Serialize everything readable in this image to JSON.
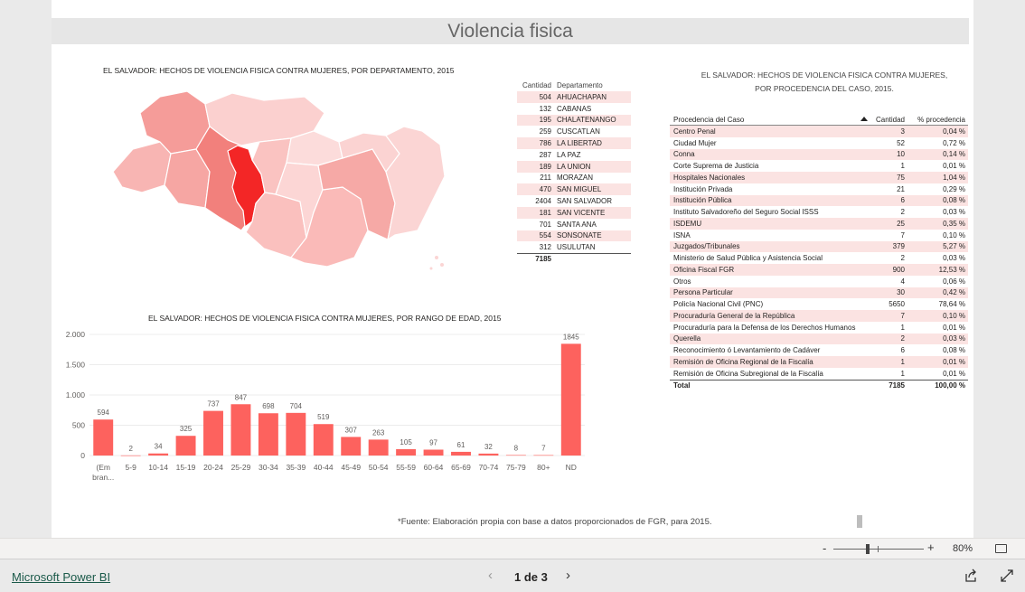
{
  "page_title": "Violencia fisica",
  "map_title": "EL SALVADOR: HECHOS DE VIOLENCIA FISICA CONTRA MUJERES, POR DEPARTAMENTO, 2015",
  "dept_table": {
    "headers": [
      "Cantidad",
      "Departamento"
    ],
    "rows": [
      {
        "qty": "504",
        "dept": "AHUACHAPAN"
      },
      {
        "qty": "132",
        "dept": "CABANAS"
      },
      {
        "qty": "195",
        "dept": "CHALATENANGO"
      },
      {
        "qty": "259",
        "dept": "CUSCATLAN"
      },
      {
        "qty": "786",
        "dept": "LA LIBERTAD"
      },
      {
        "qty": "287",
        "dept": "LA PAZ"
      },
      {
        "qty": "189",
        "dept": "LA UNION"
      },
      {
        "qty": "211",
        "dept": "MORAZAN"
      },
      {
        "qty": "470",
        "dept": "SAN MIGUEL"
      },
      {
        "qty": "2404",
        "dept": "SAN SALVADOR"
      },
      {
        "qty": "181",
        "dept": "SAN VICENTE"
      },
      {
        "qty": "701",
        "dept": "SANTA ANA"
      },
      {
        "qty": "554",
        "dept": "SONSONATE"
      },
      {
        "qty": "312",
        "dept": "USULUTAN"
      }
    ],
    "total": "7185"
  },
  "proc_title_line1": "EL SALVADOR: HECHOS DE VIOLENCIA FISICA CONTRA MUJERES,",
  "proc_title_line2": "POR PROCEDENCIA DEL CASO, 2015.",
  "proc_table": {
    "headers": [
      "Procedencia del Caso",
      "Cantidad",
      "% procedencia"
    ],
    "rows": [
      {
        "name": "Centro Penal",
        "qty": "3",
        "pct": "0,04 %"
      },
      {
        "name": "Ciudad Mujer",
        "qty": "52",
        "pct": "0,72 %"
      },
      {
        "name": "Conna",
        "qty": "10",
        "pct": "0,14 %"
      },
      {
        "name": "Corte Suprema de Justicia",
        "qty": "1",
        "pct": "0,01 %"
      },
      {
        "name": "Hospitales Nacionales",
        "qty": "75",
        "pct": "1,04 %"
      },
      {
        "name": "Institución Privada",
        "qty": "21",
        "pct": "0,29 %"
      },
      {
        "name": "Institución Pública",
        "qty": "6",
        "pct": "0,08 %"
      },
      {
        "name": "Instituto Salvadoreño del Seguro Social ISSS",
        "qty": "2",
        "pct": "0,03 %"
      },
      {
        "name": "ISDEMU",
        "qty": "25",
        "pct": "0,35 %"
      },
      {
        "name": "ISNA",
        "qty": "7",
        "pct": "0,10 %"
      },
      {
        "name": "Juzgados/Tribunales",
        "qty": "379",
        "pct": "5,27 %"
      },
      {
        "name": "Ministerio de Salud Pública y Asistencia Social",
        "qty": "2",
        "pct": "0,03 %"
      },
      {
        "name": "Oficina Fiscal FGR",
        "qty": "900",
        "pct": "12,53 %"
      },
      {
        "name": "Otros",
        "qty": "4",
        "pct": "0,06 %"
      },
      {
        "name": "Persona Particular",
        "qty": "30",
        "pct": "0,42 %"
      },
      {
        "name": "Policía Nacional Civil (PNC)",
        "qty": "5650",
        "pct": "78,64 %"
      },
      {
        "name": "Procuraduría General de la República",
        "qty": "7",
        "pct": "0,10 %"
      },
      {
        "name": "Procuraduría para la Defensa de los Derechos Humanos",
        "qty": "1",
        "pct": "0,01 %"
      },
      {
        "name": "Querella",
        "qty": "2",
        "pct": "0,03 %"
      },
      {
        "name": "Reconocimiento ó Levantamiento de Cadáver",
        "qty": "6",
        "pct": "0,08 %"
      },
      {
        "name": "Remisión de Oficina Regional de la Fiscalía",
        "qty": "1",
        "pct": "0,01 %"
      },
      {
        "name": "Remisión de Oficina Subregional de la Fiscalía",
        "qty": "1",
        "pct": "0,01 %"
      }
    ],
    "total_label": "Total",
    "total_qty": "7185",
    "total_pct": "100,00 %"
  },
  "chart_data": {
    "type": "bar",
    "title": "EL SALVADOR: HECHOS DE VIOLENCIA FISICA CONTRA MUJERES, POR RANGO DE EDAD, 2015",
    "categories": [
      "(Em bran...",
      "5-9",
      "10-14",
      "15-19",
      "20-24",
      "25-29",
      "30-34",
      "35-39",
      "40-44",
      "45-49",
      "50-54",
      "55-59",
      "60-64",
      "65-69",
      "70-74",
      "75-79",
      "80+",
      "ND"
    ],
    "values": [
      594,
      2,
      34,
      325,
      737,
      847,
      698,
      704,
      519,
      307,
      263,
      105,
      97,
      61,
      32,
      8,
      7,
      1845
    ],
    "y_ticks": [
      "0",
      "500",
      "1.000",
      "1.500",
      "2.000"
    ],
    "ylim": [
      0,
      2000
    ],
    "grid": true,
    "bar_color": "#fd625e"
  },
  "footnote": "*Fuente: Elaboración propia con base a datos proporcionados de FGR, para 2015.",
  "zoom": {
    "minus": "-",
    "plus": "+",
    "level": "80%"
  },
  "footer": {
    "brand": "Microsoft Power BI",
    "page_indicator": "1 de 3",
    "prev": "‹",
    "next": "›"
  },
  "colors": {
    "highlight": "#f32626",
    "row_alt": "#fbe3e2"
  }
}
